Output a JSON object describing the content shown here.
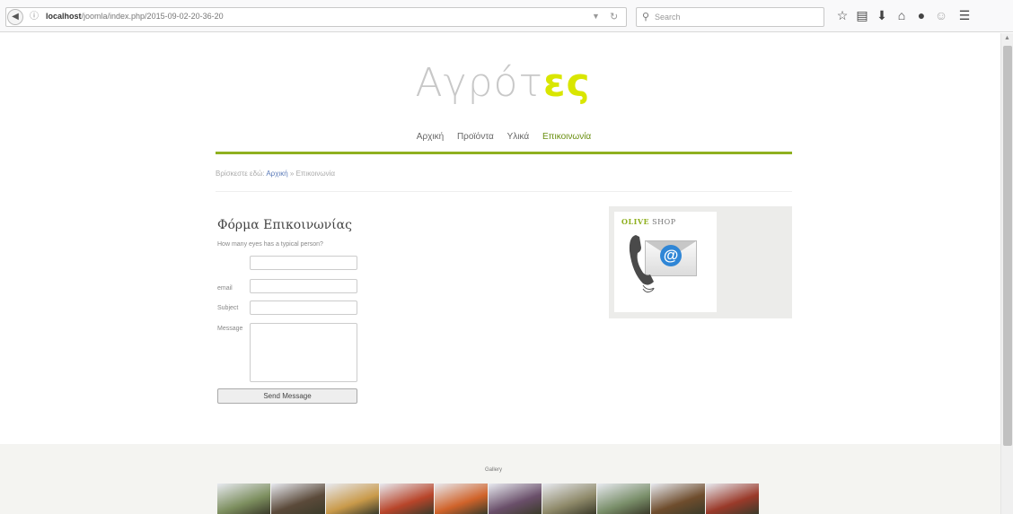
{
  "browser": {
    "url_host": "localhost",
    "url_path": "/joomla/index.php/2015-09-02-20-36-20",
    "search_placeholder": "Search"
  },
  "site": {
    "logo_main": "Αγρότ",
    "logo_accent": "ες",
    "nav": [
      {
        "label": "Αρχική",
        "active": false
      },
      {
        "label": "Προϊόντα",
        "active": false
      },
      {
        "label": "Υλικά",
        "active": false
      },
      {
        "label": "Επικοινωνία",
        "active": true
      }
    ],
    "breadcrumb": {
      "prefix": "Βρίσκεστε εδώ:",
      "home": "Αρχική",
      "separator": "»",
      "current": "Επικοινωνία"
    }
  },
  "form": {
    "title": "Φόρμα Επικοινωνίας",
    "question": "How many eyes has a typical person?",
    "email_label": "email",
    "subject_label": "Subject",
    "message_label": "Message",
    "send_label": "Send Message"
  },
  "sidebar": {
    "ad_title_main": "OLIVE",
    "ad_title_rest": " SHOP"
  },
  "footer": {
    "gallery_label": "Gallery",
    "thumbnails": [
      "#7d8f5f",
      "#5b4a3a",
      "#c99a4a",
      "#b8452a",
      "#d0632a",
      "#6a4f6a",
      "#8f8a6a",
      "#7a8f6a",
      "#6f4d2d",
      "#9a3a2a"
    ]
  }
}
